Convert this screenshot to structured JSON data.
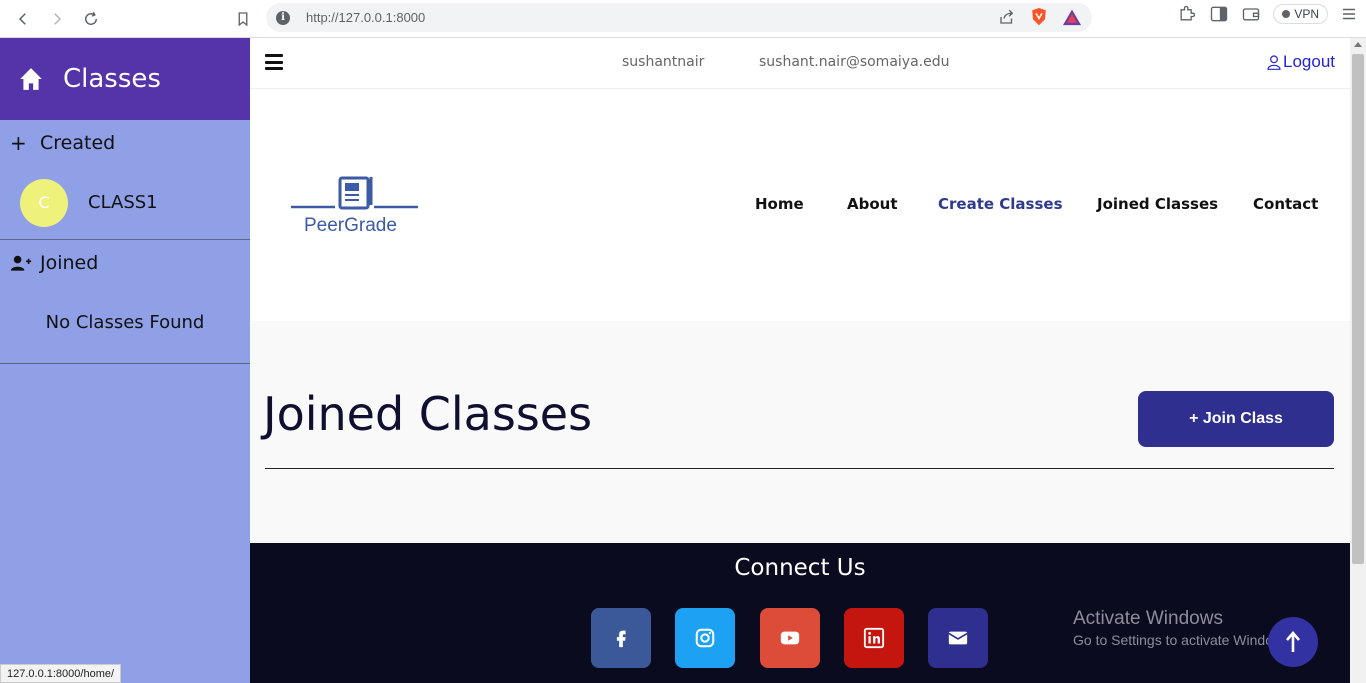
{
  "browser": {
    "url": "http://127.0.0.1:8000",
    "vpn_label": "VPN",
    "status_url": "127.0.0.1:8000/home/"
  },
  "sidebar": {
    "title": "Classes",
    "created_label": "Created",
    "created_classes": [
      {
        "avatar": "C",
        "name": "CLASS1"
      }
    ],
    "joined_label": "Joined",
    "joined_empty": "No Classes Found"
  },
  "topbar": {
    "username": "sushantnair",
    "email": "sushant.nair@somaiya.edu",
    "logout": "Logout"
  },
  "header": {
    "logo_text": "PeerGrade",
    "nav": [
      {
        "label": "Home",
        "active": false
      },
      {
        "label": "About",
        "active": false
      },
      {
        "label": "Create Classes",
        "active": true
      },
      {
        "label": "Joined Classes",
        "active": false
      },
      {
        "label": "Contact",
        "active": false
      }
    ]
  },
  "hero": {
    "title": "Joined Classes",
    "join_button": "+ Join Class"
  },
  "footer": {
    "title": "Connect Us",
    "socials": [
      {
        "icon": "facebook-icon",
        "color": "#3b5998"
      },
      {
        "icon": "instagram-icon",
        "color": "#1da1f2"
      },
      {
        "icon": "youtube-icon",
        "color": "#dd4b39"
      },
      {
        "icon": "linkedin-icon",
        "color": "#c4150f"
      },
      {
        "icon": "email-icon",
        "color": "#2e2f8f"
      }
    ]
  },
  "watermark": {
    "line1": "Activate Windows",
    "line2": "Go to Settings to activate Windows."
  },
  "colors": {
    "sidebar_bg": "#8fa0e6",
    "sidebar_header": "#5533a8",
    "accent": "#2e2f8f",
    "footer_bg": "#0b0b1f"
  }
}
